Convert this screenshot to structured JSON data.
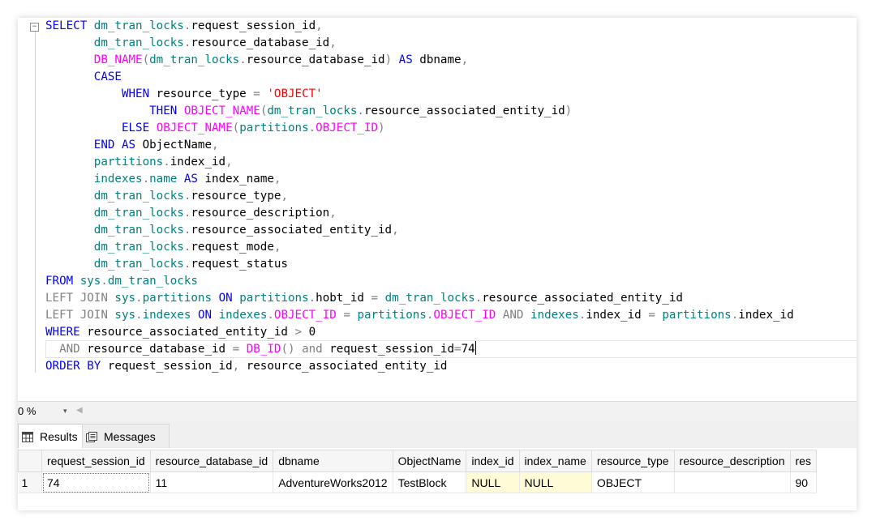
{
  "editor": {
    "collapse_glyph": "−",
    "lines": [
      [
        {
          "k": "kw",
          "t": "SELECT "
        },
        {
          "k": "id",
          "t": "dm_tran_locks"
        },
        {
          "k": "gray",
          "t": "."
        },
        {
          "k": "text",
          "t": "request_session_id"
        },
        {
          "k": "gray",
          "t": ","
        }
      ],
      [
        {
          "k": "text",
          "t": "       "
        },
        {
          "k": "id",
          "t": "dm_tran_locks"
        },
        {
          "k": "gray",
          "t": "."
        },
        {
          "k": "text",
          "t": "resource_database_id"
        },
        {
          "k": "gray",
          "t": ","
        }
      ],
      [
        {
          "k": "text",
          "t": "       "
        },
        {
          "k": "fn",
          "t": "DB_NAME"
        },
        {
          "k": "gray",
          "t": "("
        },
        {
          "k": "id",
          "t": "dm_tran_locks"
        },
        {
          "k": "gray",
          "t": "."
        },
        {
          "k": "text",
          "t": "resource_database_id"
        },
        {
          "k": "gray",
          "t": ") "
        },
        {
          "k": "kw",
          "t": "AS"
        },
        {
          "k": "text",
          "t": " dbname"
        },
        {
          "k": "gray",
          "t": ","
        }
      ],
      [
        {
          "k": "text",
          "t": "       "
        },
        {
          "k": "kw",
          "t": "CASE"
        }
      ],
      [
        {
          "k": "text",
          "t": "           "
        },
        {
          "k": "kw",
          "t": "WHEN"
        },
        {
          "k": "text",
          "t": " resource_type "
        },
        {
          "k": "gray",
          "t": "="
        },
        {
          "k": "text",
          "t": " "
        },
        {
          "k": "str",
          "t": "'OBJECT'"
        }
      ],
      [
        {
          "k": "text",
          "t": "               "
        },
        {
          "k": "kw",
          "t": "THEN"
        },
        {
          "k": "text",
          "t": " "
        },
        {
          "k": "fn",
          "t": "OBJECT_NAME"
        },
        {
          "k": "gray",
          "t": "("
        },
        {
          "k": "id",
          "t": "dm_tran_locks"
        },
        {
          "k": "gray",
          "t": "."
        },
        {
          "k": "text",
          "t": "resource_associated_entity_id"
        },
        {
          "k": "gray",
          "t": ")"
        }
      ],
      [
        {
          "k": "text",
          "t": "           "
        },
        {
          "k": "kw",
          "t": "ELSE"
        },
        {
          "k": "text",
          "t": " "
        },
        {
          "k": "fn",
          "t": "OBJECT_NAME"
        },
        {
          "k": "gray",
          "t": "("
        },
        {
          "k": "id",
          "t": "partitions"
        },
        {
          "k": "gray",
          "t": "."
        },
        {
          "k": "fn",
          "t": "OBJECT_ID"
        },
        {
          "k": "gray",
          "t": ")"
        }
      ],
      [
        {
          "k": "text",
          "t": "       "
        },
        {
          "k": "kw",
          "t": "END AS"
        },
        {
          "k": "text",
          "t": " ObjectName"
        },
        {
          "k": "gray",
          "t": ","
        }
      ],
      [
        {
          "k": "text",
          "t": "       "
        },
        {
          "k": "id",
          "t": "partitions"
        },
        {
          "k": "gray",
          "t": "."
        },
        {
          "k": "text",
          "t": "index_id"
        },
        {
          "k": "gray",
          "t": ","
        }
      ],
      [
        {
          "k": "text",
          "t": "       "
        },
        {
          "k": "id",
          "t": "indexes"
        },
        {
          "k": "gray",
          "t": "."
        },
        {
          "k": "id",
          "t": "name"
        },
        {
          "k": "text",
          "t": " "
        },
        {
          "k": "kw",
          "t": "AS"
        },
        {
          "k": "text",
          "t": " index_name"
        },
        {
          "k": "gray",
          "t": ","
        }
      ],
      [
        {
          "k": "text",
          "t": "       "
        },
        {
          "k": "id",
          "t": "dm_tran_locks"
        },
        {
          "k": "gray",
          "t": "."
        },
        {
          "k": "text",
          "t": "resource_type"
        },
        {
          "k": "gray",
          "t": ","
        }
      ],
      [
        {
          "k": "text",
          "t": "       "
        },
        {
          "k": "id",
          "t": "dm_tran_locks"
        },
        {
          "k": "gray",
          "t": "."
        },
        {
          "k": "text",
          "t": "resource_description"
        },
        {
          "k": "gray",
          "t": ","
        }
      ],
      [
        {
          "k": "text",
          "t": "       "
        },
        {
          "k": "id",
          "t": "dm_tran_locks"
        },
        {
          "k": "gray",
          "t": "."
        },
        {
          "k": "text",
          "t": "resource_associated_entity_id"
        },
        {
          "k": "gray",
          "t": ","
        }
      ],
      [
        {
          "k": "text",
          "t": "       "
        },
        {
          "k": "id",
          "t": "dm_tran_locks"
        },
        {
          "k": "gray",
          "t": "."
        },
        {
          "k": "text",
          "t": "request_mode"
        },
        {
          "k": "gray",
          "t": ","
        }
      ],
      [
        {
          "k": "text",
          "t": "       "
        },
        {
          "k": "id",
          "t": "dm_tran_locks"
        },
        {
          "k": "gray",
          "t": "."
        },
        {
          "k": "text",
          "t": "request_status"
        }
      ],
      [
        {
          "k": "kw",
          "t": "FROM"
        },
        {
          "k": "text",
          "t": " "
        },
        {
          "k": "id",
          "t": "sys"
        },
        {
          "k": "gray",
          "t": "."
        },
        {
          "k": "id",
          "t": "dm_tran_locks"
        }
      ],
      [
        {
          "k": "gray",
          "t": "LEFT JOIN"
        },
        {
          "k": "text",
          "t": " "
        },
        {
          "k": "id",
          "t": "sys"
        },
        {
          "k": "gray",
          "t": "."
        },
        {
          "k": "id",
          "t": "partitions"
        },
        {
          "k": "text",
          "t": " "
        },
        {
          "k": "kw",
          "t": "ON"
        },
        {
          "k": "text",
          "t": " "
        },
        {
          "k": "id",
          "t": "partitions"
        },
        {
          "k": "gray",
          "t": "."
        },
        {
          "k": "text",
          "t": "hobt_id "
        },
        {
          "k": "gray",
          "t": "="
        },
        {
          "k": "text",
          "t": " "
        },
        {
          "k": "id",
          "t": "dm_tran_locks"
        },
        {
          "k": "gray",
          "t": "."
        },
        {
          "k": "text",
          "t": "resource_associated_entity_id"
        }
      ],
      [
        {
          "k": "gray",
          "t": "LEFT JOIN"
        },
        {
          "k": "text",
          "t": " "
        },
        {
          "k": "id",
          "t": "sys"
        },
        {
          "k": "gray",
          "t": "."
        },
        {
          "k": "id",
          "t": "indexes"
        },
        {
          "k": "text",
          "t": " "
        },
        {
          "k": "kw",
          "t": "ON"
        },
        {
          "k": "text",
          "t": " "
        },
        {
          "k": "id",
          "t": "indexes"
        },
        {
          "k": "gray",
          "t": "."
        },
        {
          "k": "fn",
          "t": "OBJECT_ID"
        },
        {
          "k": "text",
          "t": " "
        },
        {
          "k": "gray",
          "t": "="
        },
        {
          "k": "text",
          "t": " "
        },
        {
          "k": "id",
          "t": "partitions"
        },
        {
          "k": "gray",
          "t": "."
        },
        {
          "k": "fn",
          "t": "OBJECT_ID"
        },
        {
          "k": "text",
          "t": " "
        },
        {
          "k": "gray",
          "t": "AND"
        },
        {
          "k": "text",
          "t": " "
        },
        {
          "k": "id",
          "t": "indexes"
        },
        {
          "k": "gray",
          "t": "."
        },
        {
          "k": "text",
          "t": "index_id "
        },
        {
          "k": "gray",
          "t": "="
        },
        {
          "k": "text",
          "t": " "
        },
        {
          "k": "id",
          "t": "partitions"
        },
        {
          "k": "gray",
          "t": "."
        },
        {
          "k": "text",
          "t": "index_id"
        }
      ],
      [
        {
          "k": "kw",
          "t": "WHERE"
        },
        {
          "k": "text",
          "t": " resource_associated_entity_id "
        },
        {
          "k": "gray",
          "t": ">"
        },
        {
          "k": "text",
          "t": " 0"
        }
      ],
      [
        {
          "k": "text",
          "t": "  "
        },
        {
          "k": "gray",
          "t": "AND"
        },
        {
          "k": "text",
          "t": " resource_database_id "
        },
        {
          "k": "gray",
          "t": "="
        },
        {
          "k": "text",
          "t": " "
        },
        {
          "k": "fn",
          "t": "DB_ID"
        },
        {
          "k": "gray",
          "t": "()"
        },
        {
          "k": "text",
          "t": " "
        },
        {
          "k": "gray",
          "t": "and"
        },
        {
          "k": "text",
          "t": " request_session_id"
        },
        {
          "k": "gray",
          "t": "="
        },
        {
          "k": "text",
          "t": "74"
        }
      ],
      [
        {
          "k": "kw",
          "t": "ORDER BY"
        },
        {
          "k": "text",
          "t": " request_session_id"
        },
        {
          "k": "gray",
          "t": ","
        },
        {
          "k": "text",
          "t": " resource_associated_entity_id"
        }
      ]
    ]
  },
  "zoom": {
    "value": "0 %",
    "dropdown_icon": "▾",
    "scroll_left_icon": "◀"
  },
  "tabs": {
    "results": "Results",
    "messages": "Messages"
  },
  "grid": {
    "columns": [
      "request_session_id",
      "resource_database_id",
      "dbname",
      "ObjectName",
      "index_id",
      "index_name",
      "resource_type",
      "resource_description",
      "res"
    ],
    "rows": [
      {
        "rownum": "1",
        "cells": [
          "74",
          "11",
          "AdventureWorks2012",
          "TestBlock",
          "NULL",
          "NULL",
          "OBJECT",
          "",
          "90"
        ]
      }
    ]
  },
  "colors": {
    "keyword": "#0000ff",
    "function": "#ff00ff",
    "identifier": "#008080",
    "string": "#ff0000",
    "operator": "#808080",
    "null_cell_bg": "#fffbd6"
  }
}
